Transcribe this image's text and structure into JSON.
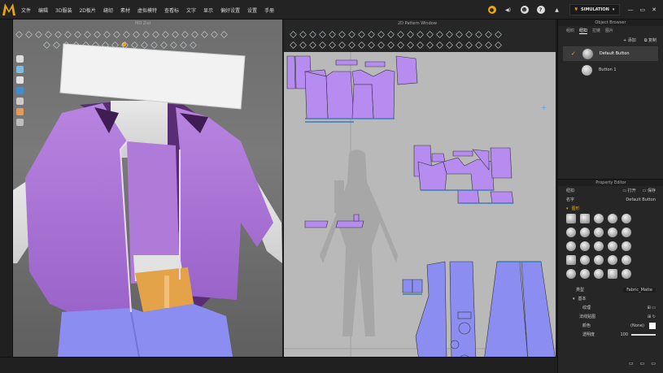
{
  "app": {
    "menu": [
      "文件",
      "编辑",
      "3D服装",
      "2D板片",
      "缝纫",
      "素材",
      "虚拟模特",
      "查看标",
      "文字",
      "显示",
      "偏好设置",
      "设置",
      "手册"
    ],
    "mode_label": "SIMULATION",
    "accent_color": "#e7a80d"
  },
  "view3d": {
    "title": "MD Ziet"
  },
  "view2d": {
    "title": "2D Pattern Window"
  },
  "object_browser": {
    "title": "Object Browser",
    "tabs": [
      "组织",
      "纽扣",
      "拉链",
      "图片"
    ],
    "add_label": "添加",
    "copy_label": "复制",
    "items": [
      {
        "label": "Default Button",
        "selected": true
      },
      {
        "label": "Button 1",
        "selected": false
      }
    ]
  },
  "property_editor": {
    "title": "Property Editor",
    "open_label": "打开",
    "save_label": "保存",
    "name_label": "名字",
    "name_value": "Default Button",
    "graphic_label": "图形",
    "type_label": "类型",
    "type_value": "Fabric_Matte",
    "basic_label": "基本",
    "texture_label": "纹理",
    "normal_label": "法线贴图",
    "color_label": "颜色",
    "color_value": "(None)",
    "opacity_label": "透明度",
    "opacity_value": "100",
    "size_label": "1.2"
  }
}
